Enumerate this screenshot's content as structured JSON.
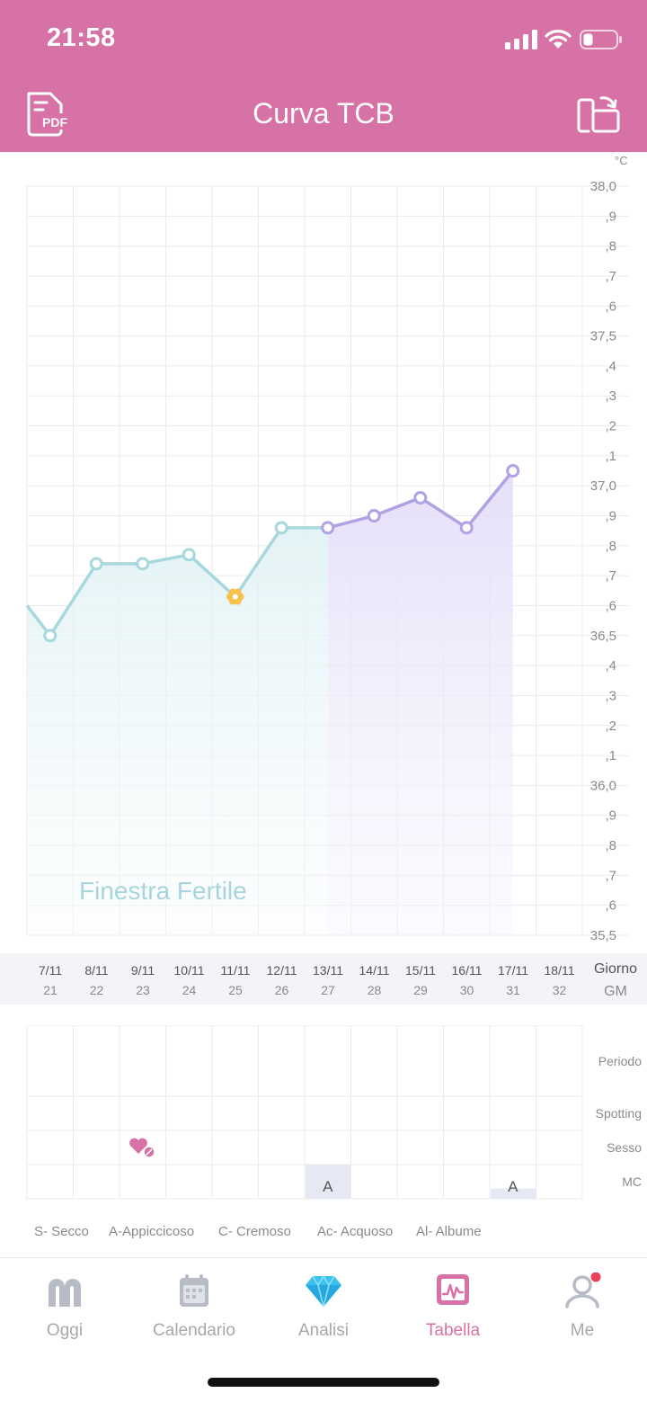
{
  "status_bar": {
    "time": "21:58"
  },
  "header": {
    "title": "Curva TCB",
    "pdf_label": "PDF"
  },
  "chart_data": {
    "type": "line",
    "title": "Curva TCB",
    "unit": "°C",
    "y_tick_labels": [
      "38,0",
      ",9",
      ",8",
      ",7",
      ",6",
      "37,5",
      ",4",
      ",3",
      ",2",
      ",1",
      "37,0",
      ",9",
      ",8",
      ",7",
      ",6",
      "36,5",
      ",4",
      ",3",
      ",2",
      ",1",
      "36,0",
      ",9",
      ",8",
      ",7",
      ",6",
      "35,5"
    ],
    "ylim": [
      35.5,
      38.0
    ],
    "grid": true,
    "categories": [
      "7/11",
      "8/11",
      "9/11",
      "10/11",
      "11/11",
      "12/11",
      "13/11",
      "14/11",
      "15/11",
      "16/11",
      "17/11",
      "18/11"
    ],
    "cycle_days": [
      "21",
      "22",
      "23",
      "24",
      "25",
      "26",
      "27",
      "28",
      "29",
      "30",
      "31",
      "32"
    ],
    "previous_value": 36.6,
    "series": [
      {
        "color": "#a7d8de",
        "points": [
          {
            "x": "7/11",
            "y": 36.5
          },
          {
            "x": "8/11",
            "y": 36.74
          },
          {
            "x": "9/11",
            "y": 36.74
          },
          {
            "x": "10/11",
            "y": 36.77
          },
          {
            "x": "11/11",
            "y": 36.63,
            "marker": "ovulation-flower"
          },
          {
            "x": "12/11",
            "y": 36.86
          },
          {
            "x": "13/11",
            "y": 36.86
          }
        ]
      },
      {
        "color": "#b1a2e3",
        "points": [
          {
            "x": "13/11",
            "y": 36.86
          },
          {
            "x": "14/11",
            "y": 36.9
          },
          {
            "x": "15/11",
            "y": 36.96
          },
          {
            "x": "16/11",
            "y": 36.86
          },
          {
            "x": "17/11",
            "y": 37.05
          }
        ]
      }
    ],
    "fertile_window_label": "Finestra Fertile"
  },
  "dates_band": {
    "day_label": "Giorno",
    "cycle_label": "GM"
  },
  "tracking": {
    "rows": [
      "Periodo",
      "Spotting",
      "Sesso",
      "MC"
    ],
    "sex_marker": {
      "day": "9/11",
      "icon": "heart-with-protection-icon"
    },
    "mc_values": [
      {
        "day": "13/11",
        "value": "A",
        "fill_fraction": 1.0
      },
      {
        "day": "17/11",
        "value": "A",
        "fill_fraction": 0.3
      }
    ]
  },
  "legend": [
    {
      "text": "S- Secco"
    },
    {
      "text": "A-Appiccicoso"
    },
    {
      "text": "C- Cremoso"
    },
    {
      "text": "Ac- Acquoso"
    },
    {
      "text": "Al- Albume"
    }
  ],
  "tabs": [
    {
      "id": "oggi",
      "label": "Oggi",
      "icon": "arch-icon"
    },
    {
      "id": "calendario",
      "label": "Calendario",
      "icon": "calendar-icon"
    },
    {
      "id": "analisi",
      "label": "Analisi",
      "icon": "diamond-icon"
    },
    {
      "id": "tabella",
      "label": "Tabella",
      "icon": "chart-icon",
      "active": true
    },
    {
      "id": "me",
      "label": "Me",
      "icon": "profile-icon",
      "badge": true
    }
  ],
  "colors": {
    "brand": "#d672a6",
    "follicular_line": "#a7d8de",
    "luteal_line": "#b1a2e3",
    "ovulation_marker": "#f5c24c",
    "grid": "#ebebeb",
    "mc_fill": "#e6e8f4",
    "diamond": "#3fc1f0",
    "badge": "#e8425a"
  }
}
